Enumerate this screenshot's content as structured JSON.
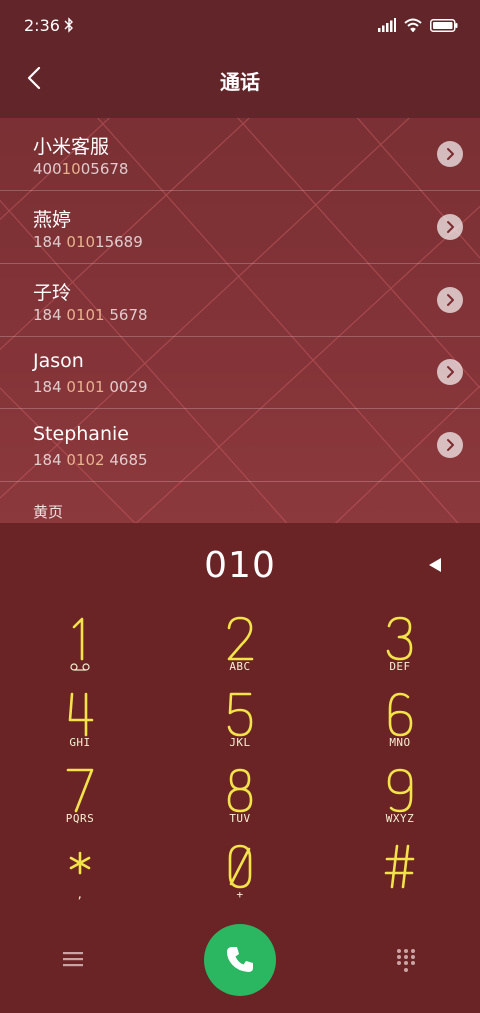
{
  "status": {
    "time": "2:36",
    "icons": [
      "bluetooth-icon",
      "signal-icon",
      "wifi-icon",
      "battery-icon"
    ]
  },
  "header": {
    "title": "通话",
    "back_icon": "chevron-left-icon"
  },
  "results": [
    {
      "name": "小米客服",
      "number_pre": "400",
      "number_hl": "10",
      "number_post": "05678"
    },
    {
      "name": "燕婷",
      "number_pre": "184 ",
      "number_hl": "010",
      "number_post": "15689"
    },
    {
      "name": "子玲",
      "number_pre": "184 ",
      "number_hl": "0101",
      "number_post": " 5678"
    },
    {
      "name": "Jason",
      "number_pre": "184 ",
      "number_hl": "0101",
      "number_post": " 0029"
    },
    {
      "name": "Stephanie",
      "number_pre": "184 ",
      "number_hl": "0102",
      "number_post": " 4685"
    }
  ],
  "yellow_pages_label": "黄页",
  "dialer": {
    "input": "010",
    "delete_icon": "backspace-triangle-icon"
  },
  "keys": [
    {
      "digit": "1",
      "letters": ""
    },
    {
      "digit": "2",
      "letters": "ABC"
    },
    {
      "digit": "3",
      "letters": "DEF"
    },
    {
      "digit": "4",
      "letters": "GHI"
    },
    {
      "digit": "5",
      "letters": "JKL"
    },
    {
      "digit": "6",
      "letters": "MNO"
    },
    {
      "digit": "7",
      "letters": "PQRS"
    },
    {
      "digit": "8",
      "letters": "TUV"
    },
    {
      "digit": "9",
      "letters": "WXYZ"
    },
    {
      "digit": "*",
      "letters": ","
    },
    {
      "digit": "0",
      "letters": "+"
    },
    {
      "digit": "#",
      "letters": ""
    }
  ],
  "colors": {
    "accent": "#f3e34a",
    "call": "#2bb761",
    "background": "#6b2426",
    "highlight": "#e9b28f"
  }
}
